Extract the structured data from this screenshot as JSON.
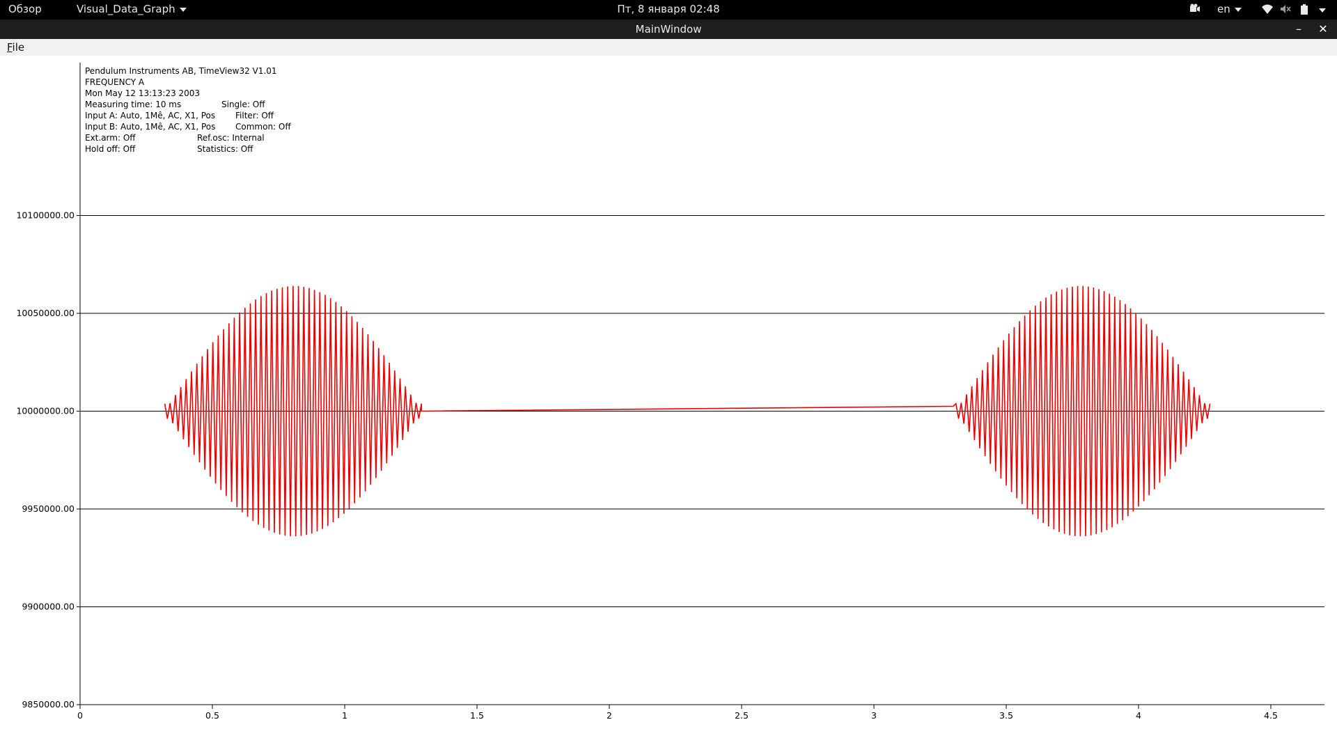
{
  "topbar": {
    "activities": "Обзор",
    "app_name": "Visual_Data_Graph",
    "clock": "Пт, 8 января  02:48",
    "language": "en"
  },
  "window": {
    "title": "MainWindow",
    "minimize": "–",
    "close": "✕"
  },
  "menubar": {
    "file": "File"
  },
  "info": {
    "line1": "Pendulum Instruments AB, TimeView32 V1.01",
    "line2": "FREQUENCY A",
    "line3": "Mon May 12 13:13:23 2003",
    "measuring_time": "Measuring time: 10 ms",
    "single": "Single: Off",
    "input_a": "Input A: Auto, 1Mê, AC, X1, Pos",
    "filter": "Filter: Off",
    "input_b": "Input B: Auto, 1Mê, AC, X1, Pos",
    "common": "Common: Off",
    "ext_arm": "Ext.arm: Off",
    "ref_osc": "Ref.osc: Internal",
    "hold_off": "Hold off: Off",
    "statistics": "Statistics: Off"
  },
  "chart_data": {
    "type": "line",
    "title": "",
    "xlabel": "",
    "ylabel": "",
    "xlim": [
      0,
      4.7
    ],
    "ylim": [
      9850000,
      10150000
    ],
    "x_ticks": [
      "0",
      "0.5",
      "1",
      "1.5",
      "2",
      "2.5",
      "3",
      "3.5",
      "4",
      "4.5"
    ],
    "y_ticks": [
      "10100000.00",
      "10050000.00",
      "10000000.00",
      "9950000.00",
      "9900000.00",
      "9850000.00"
    ],
    "grid": "horizontal",
    "series": [
      {
        "color": "#ee0000",
        "bursts": [
          {
            "x_start": 0.32,
            "x_end": 1.29,
            "center": 10000000,
            "peak_amplitude": 64000,
            "peak_x": 0.81,
            "cycles": 48
          },
          {
            "x_start": 3.31,
            "x_end": 4.27,
            "center": 10000000,
            "peak_amplitude": 64000,
            "peak_x": 3.78,
            "cycles": 48
          }
        ],
        "segment": [
          {
            "x": 1.29,
            "y": 10000000
          },
          {
            "x": 3.3,
            "y": 10002500
          }
        ]
      }
    ]
  }
}
